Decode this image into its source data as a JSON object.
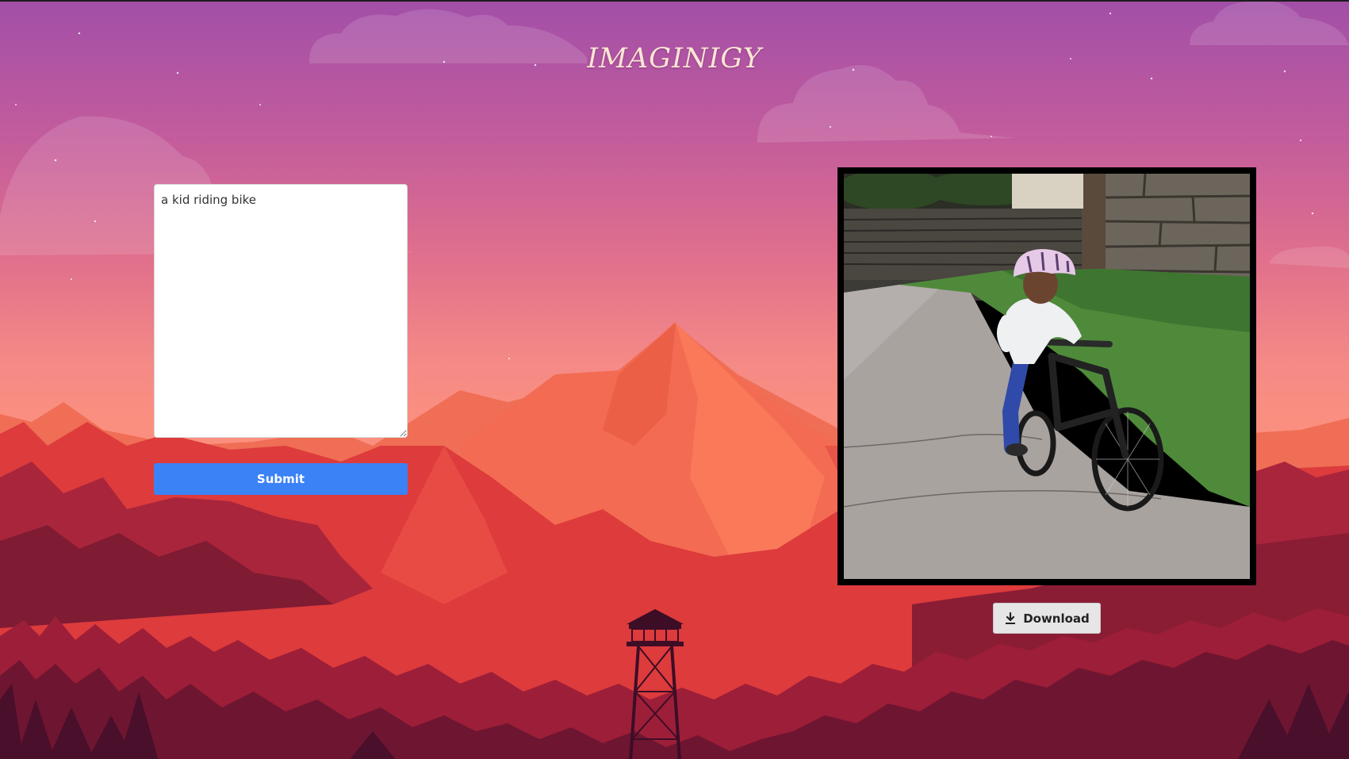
{
  "app": {
    "title": "IMAGINIGY"
  },
  "prompt": {
    "value": "a kid riding bike",
    "placeholder": ""
  },
  "submit": {
    "label": "Submit"
  },
  "download": {
    "label": "Download",
    "icon": "download-icon"
  },
  "theme": {
    "accent": "#3b82f6",
    "title_color": "#fbe6d4",
    "frame_color": "#000000"
  }
}
